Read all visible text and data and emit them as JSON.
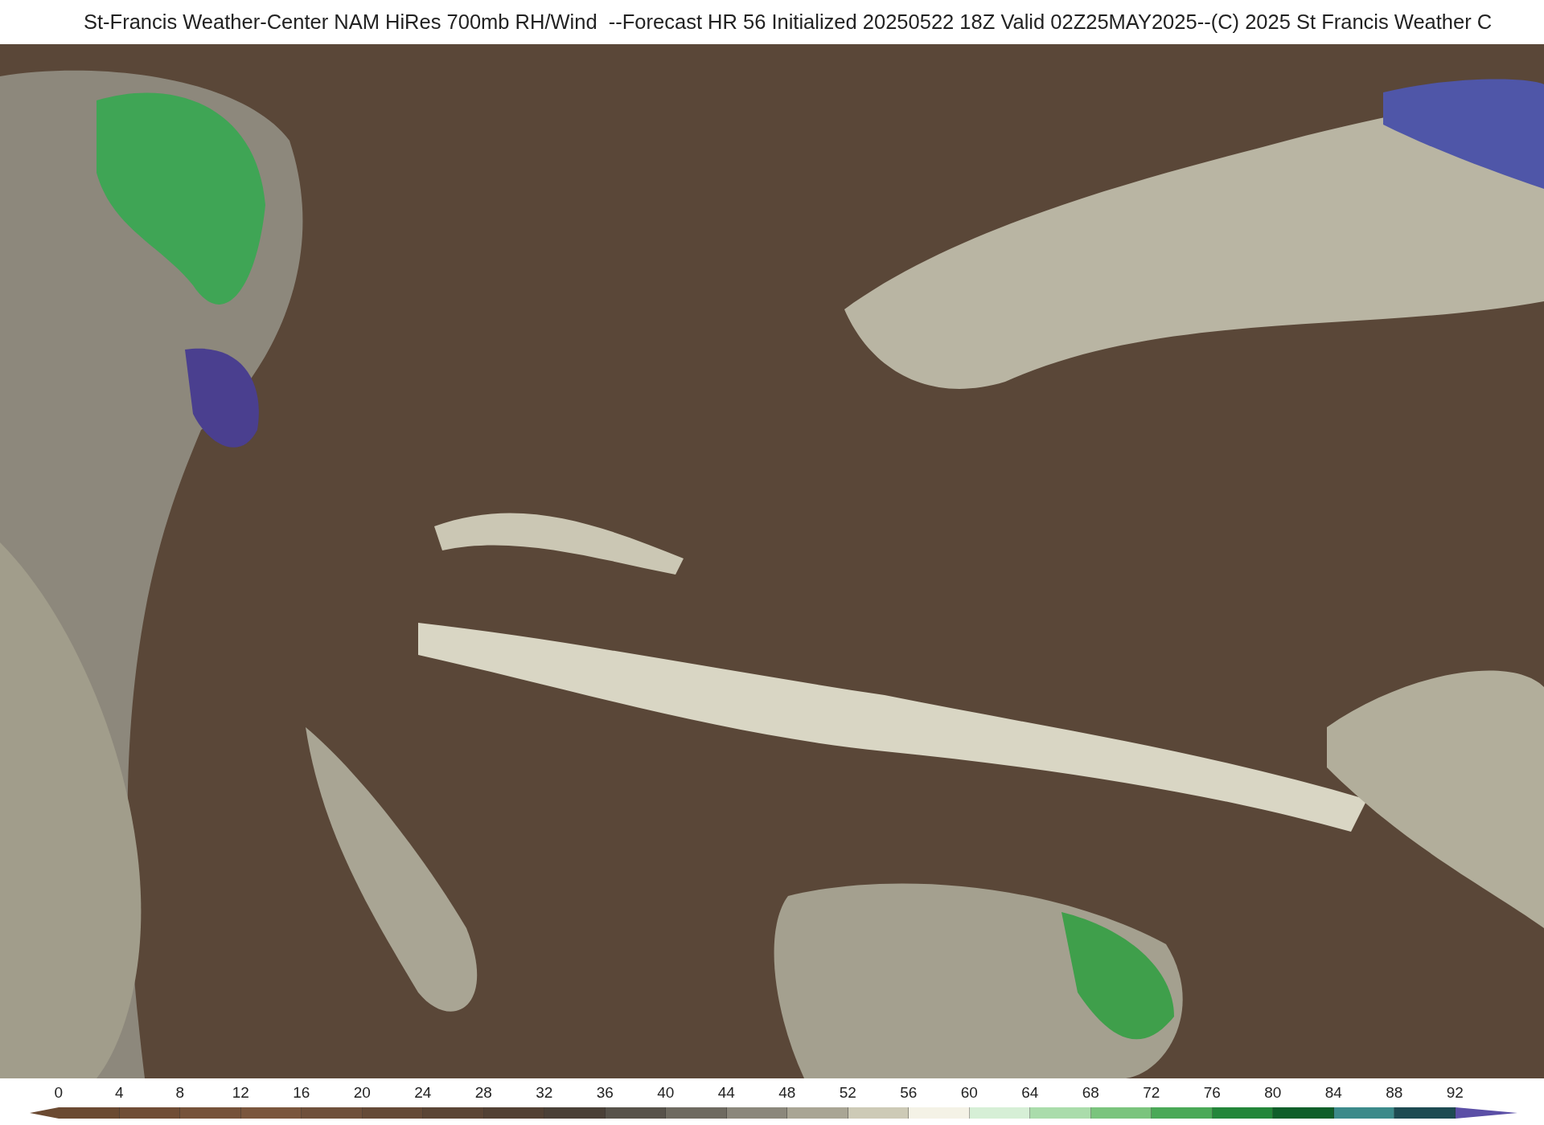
{
  "title": "St-Francis Weather-Center NAM HiRes 700mb RH/Wind  --Forecast HR 56 Initialized 20250522 18Z Valid 02Z25MAY2025--(C) 2025 St Francis Weather C",
  "colorbar": {
    "under_arrow": {
      "color": "#6b4a32"
    },
    "over_arrow": {
      "color": "#5b4fa6"
    },
    "segments": [
      {
        "color": "#6b4a32"
      },
      {
        "color": "#704d36"
      },
      {
        "color": "#76523a"
      },
      {
        "color": "#7a563d"
      },
      {
        "color": "#6f503b"
      },
      {
        "color": "#654a37"
      },
      {
        "color": "#5b4535"
      },
      {
        "color": "#524134"
      },
      {
        "color": "#4a4037"
      },
      {
        "color": "#57524a"
      },
      {
        "color": "#6e6a60"
      },
      {
        "color": "#8b877b"
      },
      {
        "color": "#a9a594"
      },
      {
        "color": "#cdcab6"
      },
      {
        "color": "#f4f2e6"
      },
      {
        "color": "#d6efd6"
      },
      {
        "color": "#aadcab"
      },
      {
        "color": "#7ac47d"
      },
      {
        "color": "#4aa957"
      },
      {
        "color": "#23863a"
      },
      {
        "color": "#0f5f2a"
      },
      {
        "color": "#3c8a8a"
      },
      {
        "color": "#1e4b52"
      }
    ],
    "ticks": [
      "0",
      "4",
      "8",
      "12",
      "16",
      "20",
      "24",
      "28",
      "32",
      "36",
      "40",
      "44",
      "48",
      "52",
      "56",
      "60",
      "64",
      "68",
      "72",
      "76",
      "80",
      "84",
      "88",
      "92"
    ]
  }
}
